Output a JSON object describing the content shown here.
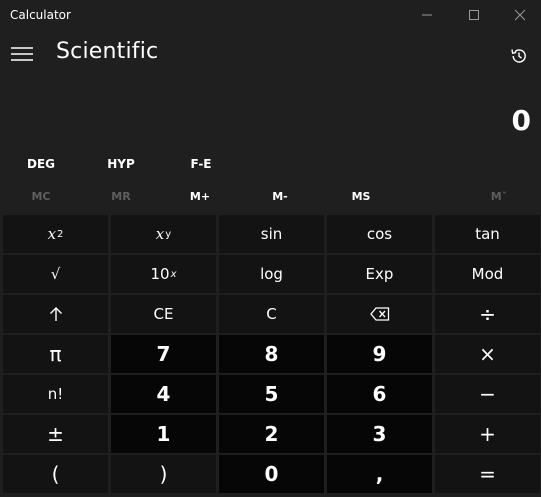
{
  "window": {
    "title": "Calculator",
    "minimize_glyph": "—",
    "maximize_glyph": "☐",
    "close_glyph": "✕"
  },
  "header": {
    "mode_title": "Scientific",
    "menu_icon": "hamburger-icon",
    "history_icon": "history-icon"
  },
  "display": {
    "value": "0"
  },
  "mode_row": {
    "deg": "DEG",
    "hyp": "HYP",
    "fe": "F-E"
  },
  "memory": {
    "mc": "MC",
    "mr": "MR",
    "mplus": "M+",
    "mminus": "M-",
    "ms": "MS",
    "mlist": "Mˇ"
  },
  "keys": {
    "x2_base": "x",
    "x2_sup": "2",
    "xy_base": "x",
    "xy_sup": "y",
    "sin": "sin",
    "cos": "cos",
    "tan": "tan",
    "sqrt": "√",
    "ten_x_base": "10",
    "ten_x_sup": "x",
    "log": "log",
    "exp": "Exp",
    "mod": "Mod",
    "shift": "↑",
    "ce": "CE",
    "c": "C",
    "backspace": "⌫",
    "divide": "÷",
    "pi": "π",
    "seven": "7",
    "eight": "8",
    "nine": "9",
    "multiply": "×",
    "fact": "n!",
    "four": "4",
    "five": "5",
    "six": "6",
    "minus": "−",
    "negate": "±",
    "one": "1",
    "two": "2",
    "three": "3",
    "plus": "+",
    "lparen": "(",
    "rparen": ")",
    "zero": "0",
    "decimal": ",",
    "equals": "="
  },
  "colors": {
    "background": "#1f1f1f",
    "function_key": "#131313",
    "number_key": "#060606",
    "disabled_text": "#5e5e5e"
  }
}
